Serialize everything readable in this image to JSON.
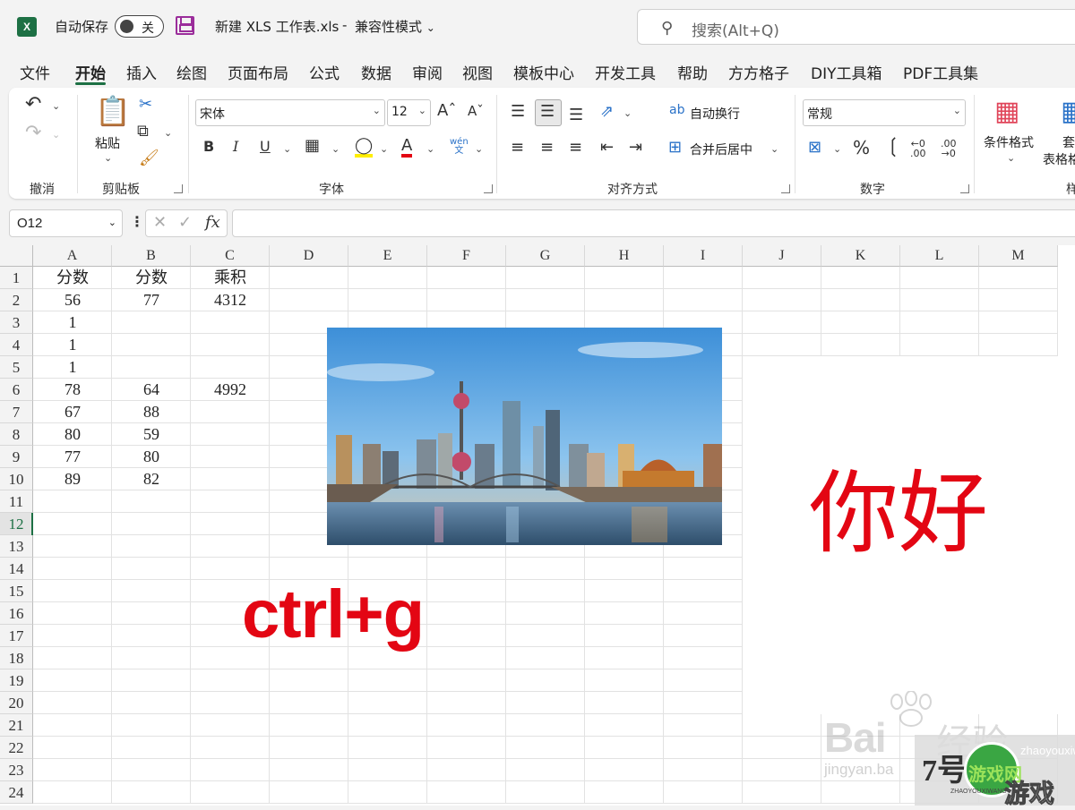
{
  "title_bar": {
    "app_logo": "X",
    "autosave_label": "自动保存",
    "autosave_state": "关",
    "file_name": "新建 XLS 工作表.xls",
    "separator": "-",
    "mode": "兼容性模式",
    "search_placeholder": "搜索(Alt+Q)"
  },
  "menu": {
    "tabs": [
      "文件",
      "开始",
      "插入",
      "绘图",
      "页面布局",
      "公式",
      "数据",
      "审阅",
      "视图",
      "模板中心",
      "开发工具",
      "帮助",
      "方方格子",
      "DIY工具箱",
      "PDF工具集"
    ],
    "active": "开始"
  },
  "ribbon": {
    "groups": {
      "undo": "撤消",
      "clipboard": "剪贴板",
      "font": "字体",
      "alignment": "对齐方式",
      "number": "数字",
      "styles": "样"
    },
    "paste_label": "粘贴",
    "font_name": "宋体",
    "font_size": "12",
    "wrap_text": "自动换行",
    "merge_center": "合并后居中",
    "number_format": "常规",
    "conditional_format": "条件格式",
    "table_format_top": "套",
    "table_format_bottom": "表格格"
  },
  "formula_bar": {
    "name_box": "O12",
    "fx": "fx",
    "formula": ""
  },
  "sheet": {
    "columns": [
      "A",
      "B",
      "C",
      "D",
      "E",
      "F",
      "G",
      "H",
      "I",
      "J",
      "K",
      "L",
      "M"
    ],
    "rows": [
      "1",
      "2",
      "3",
      "4",
      "5",
      "6",
      "7",
      "8",
      "9",
      "10",
      "11",
      "12",
      "13",
      "14",
      "15",
      "16",
      "17",
      "18",
      "19",
      "20",
      "21",
      "22",
      "23",
      "24"
    ],
    "selected_row": "12",
    "cells": [
      [
        "分数",
        "分数",
        "乘积"
      ],
      [
        "56",
        "77",
        "4312"
      ],
      [
        "1",
        "",
        ""
      ],
      [
        "1",
        "",
        ""
      ],
      [
        "1",
        "",
        ""
      ],
      [
        "78",
        "64",
        "4992"
      ],
      [
        "67",
        "88",
        ""
      ],
      [
        "80",
        "59",
        ""
      ],
      [
        "77",
        "80",
        ""
      ],
      [
        "89",
        "82",
        ""
      ]
    ]
  },
  "overlays": {
    "shortcut": "ctrl+g",
    "greeting": "你好",
    "accent_color": "#e30613"
  },
  "watermarks": {
    "baidu": "Bai",
    "jingyan": "经验",
    "url": "jingyan.ba",
    "badge_seven": "7号",
    "badge_game": "游戏网",
    "badge_you": "游戏",
    "badge_url": "zhaoyouxiwang",
    "badge_small": "ZHAOYOUXIWANG"
  }
}
